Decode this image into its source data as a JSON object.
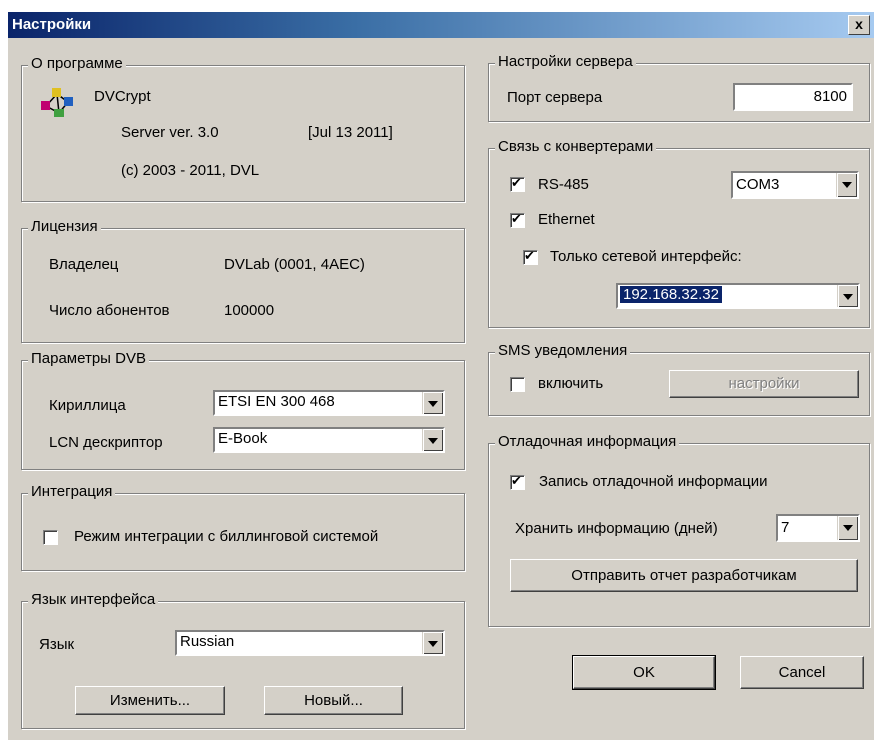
{
  "window": {
    "title": "Настройки",
    "close_label": "x"
  },
  "about": {
    "legend": "О программе",
    "app_name": "DVCrypt",
    "version": "Server ver. 3.0",
    "build_date": "[Jul 13 2011]",
    "copyright": "(c) 2003 - 2011, DVL"
  },
  "license": {
    "legend": "Лицензия",
    "owner_label": "Владелец",
    "owner_value": "DVLab (0001, 4AEC)",
    "subscribers_label": "Число абонентов",
    "subscribers_value": "100000"
  },
  "dvb": {
    "legend": "Параметры DVB",
    "cyrillic_label": "Кириллица",
    "cyrillic_value": "ETSI EN 300 468",
    "lcn_label": "LCN дескриптор",
    "lcn_value": "E-Book"
  },
  "integration": {
    "legend": "Интеграция",
    "billing_label": "Режим интеграции с биллинговой системой",
    "billing_checked": false
  },
  "language": {
    "legend": "Язык интерфейса",
    "lang_label": "Язык",
    "lang_value": "Russian",
    "change_label": "Изменить...",
    "new_label": "Новый..."
  },
  "server": {
    "legend": "Настройки сервера",
    "port_label": "Порт сервера",
    "port_value": "8100"
  },
  "converters": {
    "legend": "Связь с конвертерами",
    "rs485_label": "RS-485",
    "rs485_checked": true,
    "com_value": "COM3",
    "ethernet_label": "Ethernet",
    "ethernet_checked": true,
    "iface_only_label": "Только сетевой интерфейс:",
    "iface_only_checked": true,
    "iface_value": "192.168.32.32"
  },
  "sms": {
    "legend": "SMS уведомления",
    "enable_label": "включить",
    "enable_checked": false,
    "settings_label": "настройки"
  },
  "debug": {
    "legend": "Отладочная информация",
    "record_label": "Запись отладочной информации",
    "record_checked": true,
    "keep_label": "Хранить информацию (дней)",
    "keep_value": "7",
    "send_report_label": "Отправить отчет разработчикам"
  },
  "footer": {
    "ok_label": "OK",
    "cancel_label": "Cancel"
  }
}
